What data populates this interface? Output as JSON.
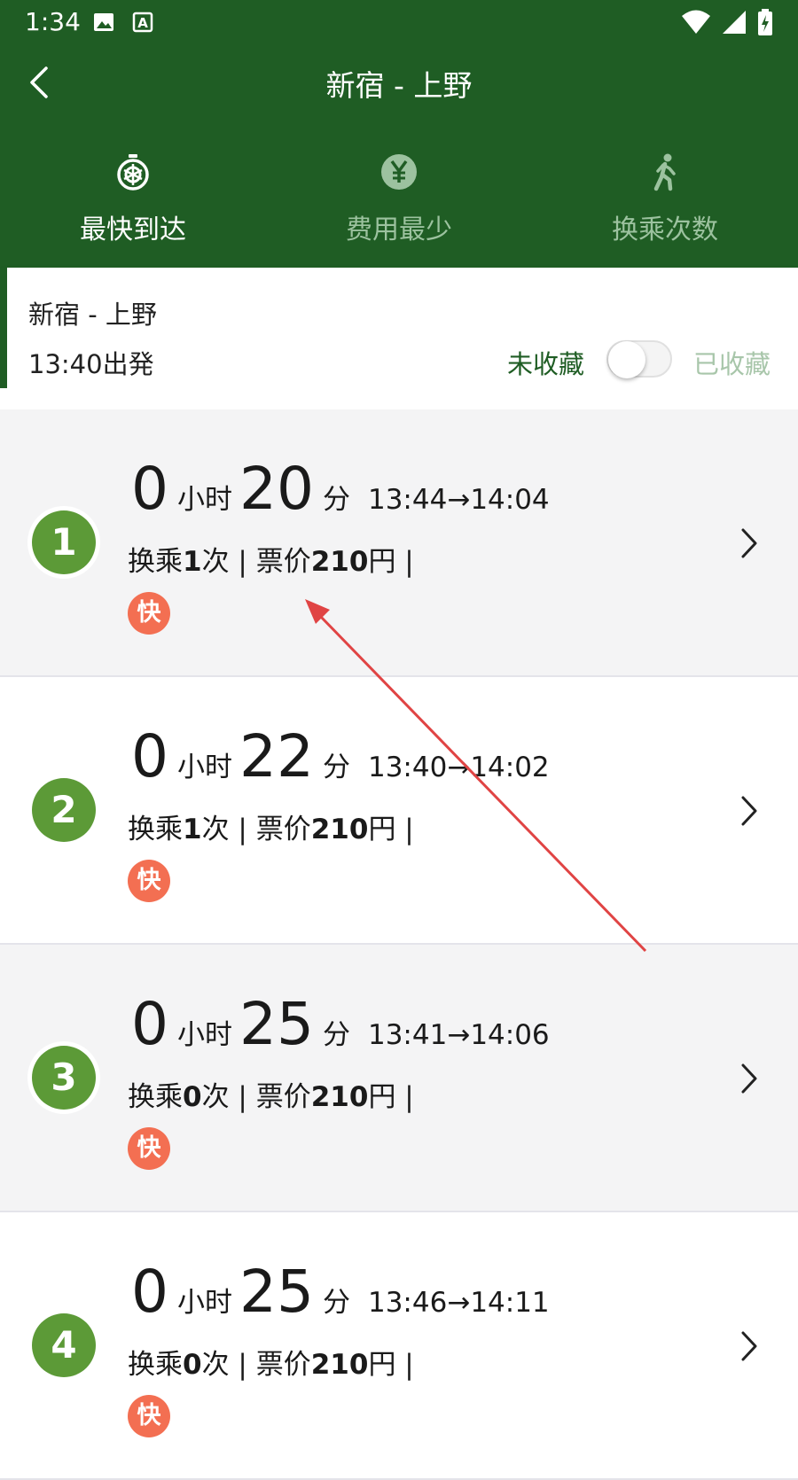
{
  "status_bar": {
    "time": "1:34"
  },
  "header": {
    "title": "新宿 - 上野"
  },
  "tabs": [
    {
      "label": "最快到达",
      "icon": "stopwatch-icon",
      "active": true
    },
    {
      "label": "费用最少",
      "icon": "yen-coin-icon",
      "active": false
    },
    {
      "label": "换乘次数",
      "icon": "walking-person-icon",
      "active": false
    }
  ],
  "summary": {
    "route": "新宿 - 上野",
    "depart": "13:40出発",
    "fav_off_label": "未收藏",
    "fav_on_label": "已收藏"
  },
  "units": {
    "hour": "小时",
    "minute": "分",
    "transfer_prefix": "换乘",
    "transfer_suffix": "次",
    "fare_prefix": "票价",
    "fare_suffix": "円",
    "fast_tag": "快"
  },
  "routes": [
    {
      "rank": "1",
      "hours": "0",
      "minutes": "20",
      "depart": "13:44",
      "arrive": "14:04",
      "transfers": "1",
      "fare": "210"
    },
    {
      "rank": "2",
      "hours": "0",
      "minutes": "22",
      "depart": "13:40",
      "arrive": "14:02",
      "transfers": "1",
      "fare": "210"
    },
    {
      "rank": "3",
      "hours": "0",
      "minutes": "25",
      "depart": "13:41",
      "arrive": "14:06",
      "transfers": "0",
      "fare": "210"
    },
    {
      "rank": "4",
      "hours": "0",
      "minutes": "25",
      "depart": "13:46",
      "arrive": "14:11",
      "transfers": "0",
      "fare": "210"
    }
  ],
  "colors": {
    "primary": "#1f5d24",
    "badge": "#5c9a37",
    "fast_tag": "#f36f52",
    "arrow": "#e04444"
  }
}
